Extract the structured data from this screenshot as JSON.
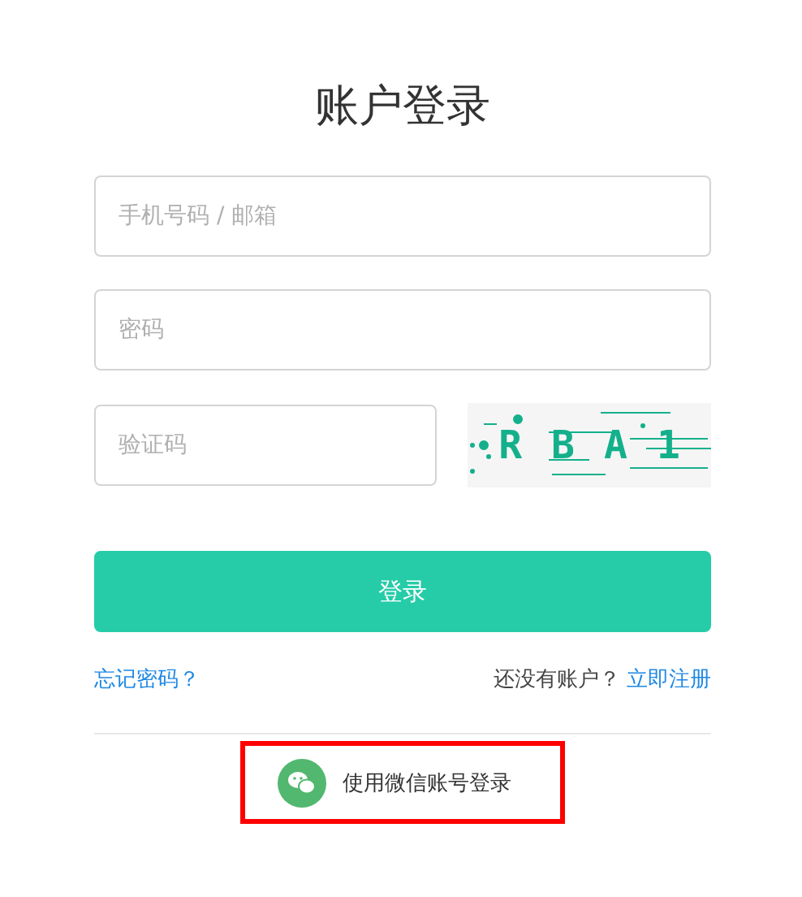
{
  "title": "账户登录",
  "fields": [
    {
      "placeholder": "手机号码 / 邮箱"
    },
    {
      "placeholder": "密码"
    }
  ],
  "captcha": {
    "placeholder": "验证码",
    "characters": [
      "R",
      "B",
      "A",
      "1"
    ]
  },
  "submit": "登录",
  "forgot_link": "忘记密码？",
  "register_prompt": "还没有账户？",
  "register_link": "立即注册",
  "wechat_login": {
    "label": "使用微信账号登录",
    "highlighted": true
  }
}
